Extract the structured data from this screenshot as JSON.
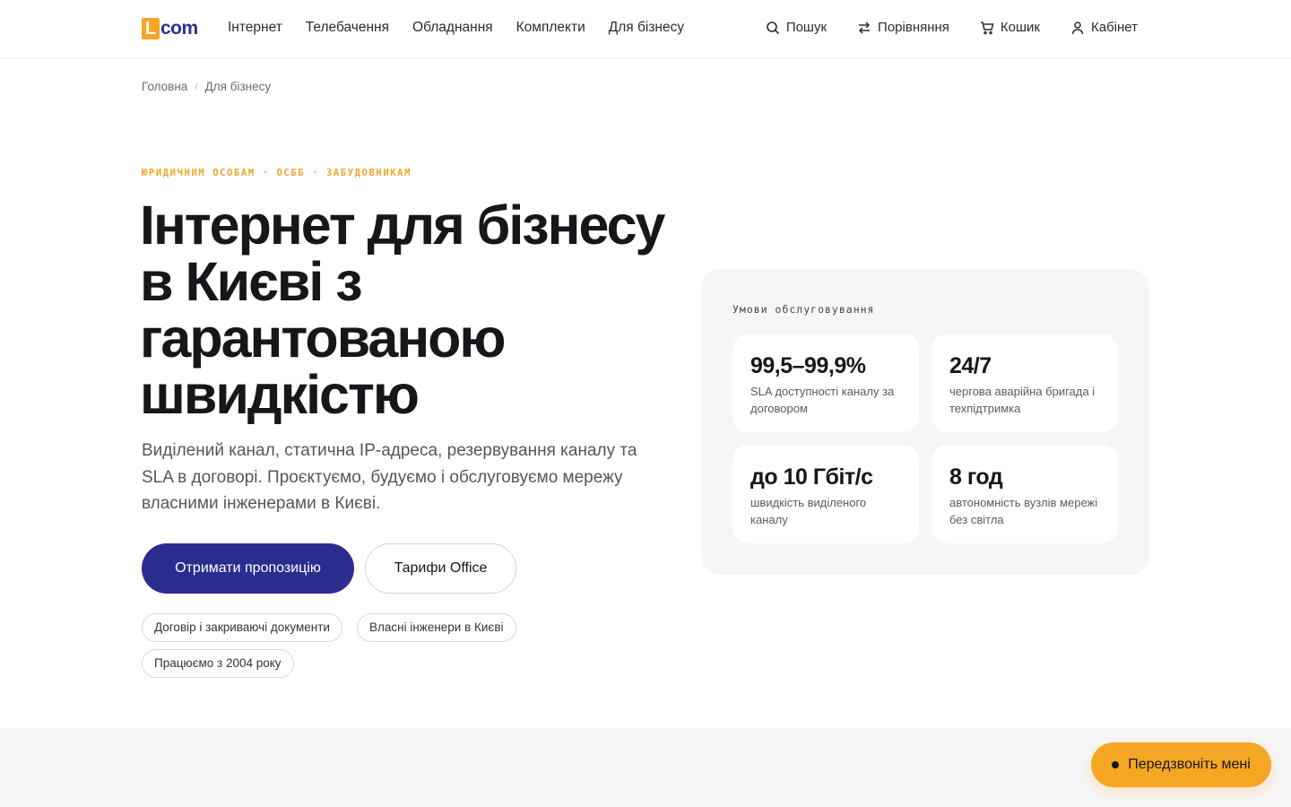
{
  "header": {
    "logo_letter": "L",
    "logo_text": "com",
    "nav": [
      "Інтернет",
      "Телебачення",
      "Обладнання",
      "Комплекти",
      "Для бізнесу"
    ],
    "search": "Пошук",
    "compare": "Порівняння",
    "cart": "Кошик",
    "account": "Кабінет"
  },
  "breadcrumb": {
    "home": "Головна",
    "separator": "/",
    "current": "Для бізнесу"
  },
  "hero": {
    "eyebrow": "ЮРИДИЧНИМ ОСОБАМ · ОСББ · ЗАБУДОВНИКАМ",
    "title_lines": [
      "Інтернет для бізнесу",
      "в Києві з",
      "гарантованою",
      "швидкістю"
    ],
    "lead": "Виділений канал, статична IP-адреса, резервування каналу та SLA в договорі. Проєктуємо, будуємо і обслуговуємо мережу власними інженерами в Києві.",
    "primary_button": "Отримати пропозицію",
    "secondary_button": "Тарифи Office",
    "chips": [
      "Договір і закриваючі документи",
      "Власні інженери в Києві",
      "Працюємо з 2004 року"
    ]
  },
  "service_card": {
    "label": "Умови обслуговування",
    "tiles": [
      {
        "value": "99,5–99,9%",
        "desc": "SLA доступності каналу за договором"
      },
      {
        "value": "24/7",
        "desc": "чергова аварійна бригада і техпідтримка"
      },
      {
        "value": "до 10 Гбіт/с",
        "desc": "швидкість виділеного каналу"
      },
      {
        "value": "8 год",
        "desc": "автономність вузлів мережі без світла"
      }
    ]
  },
  "callback_button": "Передзвоніть мені",
  "colors": {
    "brand_blue": "#2b2d8e",
    "accent_orange": "#f5a623"
  }
}
